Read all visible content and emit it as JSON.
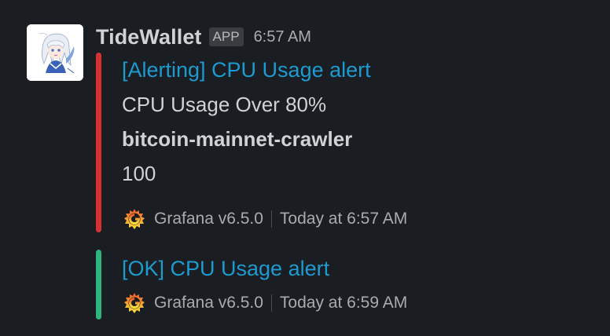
{
  "message": {
    "sender": "TideWallet",
    "app_badge": "APP",
    "timestamp": "6:57 AM"
  },
  "attachments": [
    {
      "color": "#d63232",
      "title": "[Alerting] CPU Usage alert",
      "lines": [
        "CPU Usage Over 80%",
        "bitcoin-mainnet-crawler",
        "100"
      ],
      "footer_icon": "grafana-icon",
      "footer_source": "Grafana v6.5.0",
      "footer_time": "Today at 6:57 AM"
    },
    {
      "color": "#2eb67d",
      "title": "[OK] CPU Usage alert",
      "footer_icon": "grafana-icon",
      "footer_source": "Grafana v6.5.0",
      "footer_time": "Today at 6:59 AM"
    }
  ],
  "colors": {
    "background": "#1a1d21",
    "link": "#1d9bd1",
    "alert_bar": "#d63232",
    "ok_bar": "#2eb67d"
  }
}
